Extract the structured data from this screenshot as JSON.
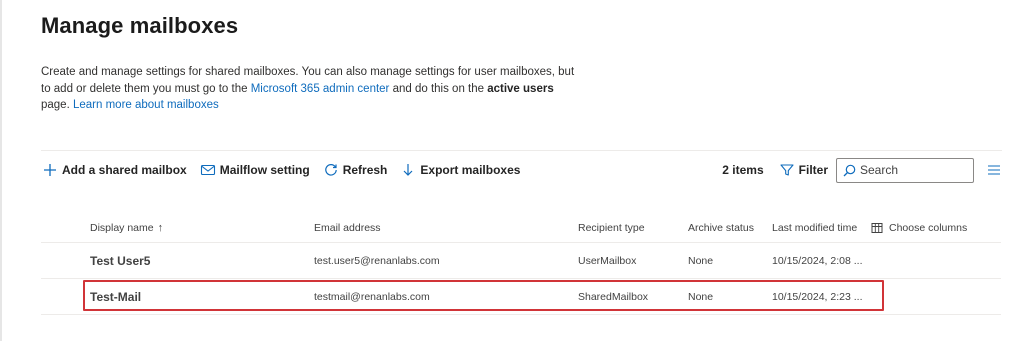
{
  "page": {
    "title": "Manage mailboxes",
    "description": {
      "text1": "Create and manage settings for shared mailboxes. You can also manage settings for user mailboxes, but to add or delete them you must go to the ",
      "link1": "Microsoft 365 admin center",
      "text2": " and do this on the ",
      "bold1": "active users",
      "text3": " page. ",
      "link2": "Learn more about mailboxes"
    }
  },
  "toolbar": {
    "add_label": "Add a shared mailbox",
    "mailflow_label": "Mailflow setting",
    "refresh_label": "Refresh",
    "export_label": "Export mailboxes",
    "items_count": "2 items",
    "filter_label": "Filter",
    "search_placeholder": "Search"
  },
  "table": {
    "columns": {
      "display_name": "Display name",
      "sort_indicator": "↑",
      "email": "Email address",
      "recipient_type": "Recipient type",
      "archive_status": "Archive status",
      "last_modified": "Last modified time",
      "choose_columns": "Choose columns"
    },
    "rows": [
      {
        "name": "Test User5",
        "email": "test.user5@renanlabs.com",
        "type": "UserMailbox",
        "archive": "None",
        "modified": "10/15/2024, 2:08 ..."
      },
      {
        "name": "Test-Mail",
        "email": "testmail@renanlabs.com",
        "type": "SharedMailbox",
        "archive": "None",
        "modified": "10/15/2024, 2:23 ..."
      }
    ]
  },
  "colors": {
    "accent": "#0f6cbd",
    "highlight_border": "#d13438"
  }
}
